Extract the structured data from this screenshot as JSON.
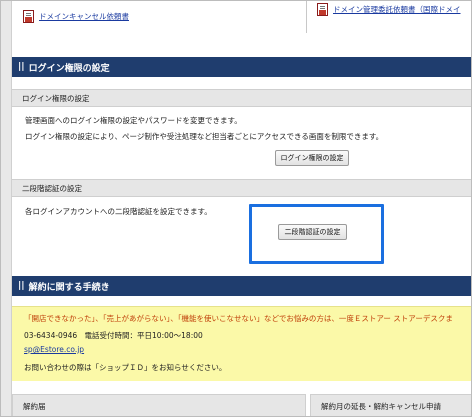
{
  "top_links": {
    "left": "ドメインキャンセル依頼書",
    "right": "ドメイン管理委託依頼書（国際ドメイ"
  },
  "login_section": {
    "title": "ログイン権限の設定",
    "bar": "||"
  },
  "login_permission": {
    "subtitle": "ログイン権限の設定",
    "line1": "管理画面へのログイン権限の設定やパスワードを変更できます。",
    "line2": "ログイン権限の設定により、ページ制作や受注処理など担当者ごとにアクセスできる画面を制限できます。",
    "button": "ログイン権限の設定"
  },
  "two_factor": {
    "subtitle": "二段階認証の設定",
    "line1": "各ログインアカウントへの二段階認証を設定できます。",
    "button": "二段階認証の設定"
  },
  "cancellation_section": {
    "title": "解約に関する手続き",
    "bar": "||"
  },
  "notice": {
    "line1": "「開店できなかった」、「売上があがらない」、「機能を使いこなせない」などでお悩みの方は、一度Ｅストアー ストアーデスクま",
    "phone": "03-6434-0946",
    "hours": "電話受付時間：平日10:00～18:00",
    "email": "sp@Estore.co.jp",
    "line_contact": "お問い合わせの際は「ショップＩＤ」をお知らせください。"
  },
  "bottom": {
    "left_header": "解約届",
    "right_header": "解約月の延長・解約キャンセル申請"
  },
  "colors": {
    "section_header": "#1f3d6e",
    "highlight": "#1a6fe0",
    "notice_bg": "#fbf9a8"
  }
}
